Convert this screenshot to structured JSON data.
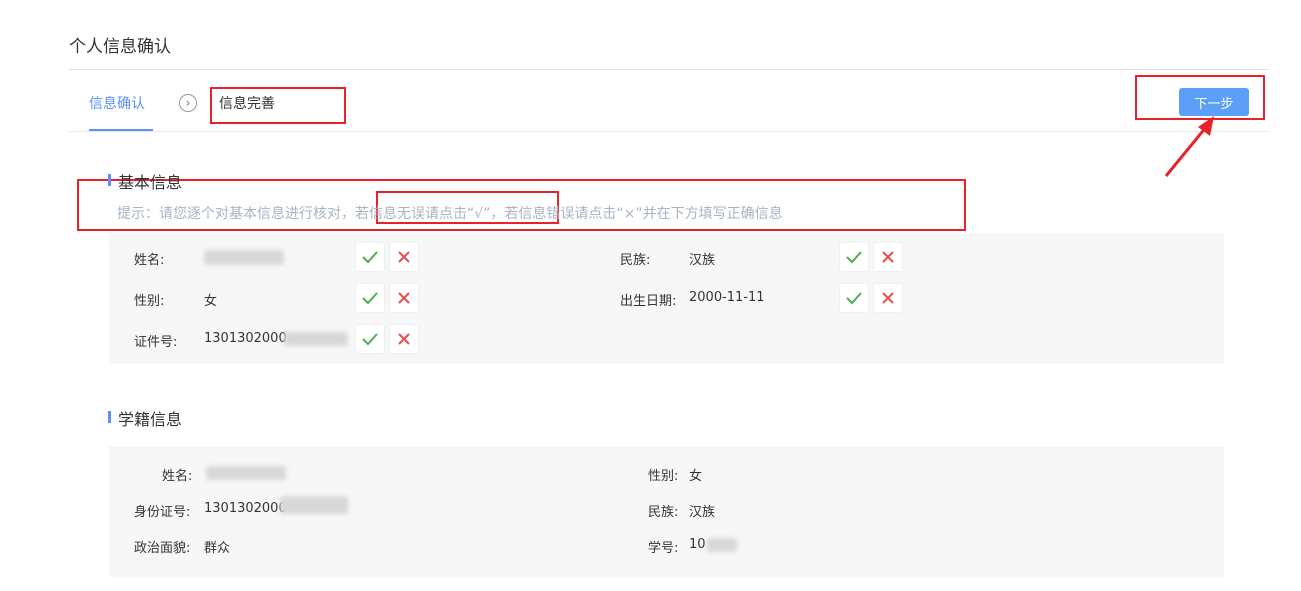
{
  "page": {
    "title": "个人信息确认"
  },
  "tabs": [
    {
      "label": "信息确认",
      "active": true
    },
    {
      "label": "信息完善",
      "active": false
    }
  ],
  "step_arrow_glyph": "›",
  "next_button": {
    "label": "下一步"
  },
  "basic_info": {
    "title": "基本信息",
    "hint": "提示：请您逐个对基本信息进行核对，若信息无误请点击“√”，若信息错误请点击“×”并在下方填写正确信息",
    "fields": [
      {
        "label": "姓名:",
        "value": ""
      },
      {
        "label": "民族:",
        "value": "汉族"
      },
      {
        "label": "性别:",
        "value": "女"
      },
      {
        "label": "出生日期:",
        "value": "2000-11-11"
      },
      {
        "label": "证件号:",
        "value": "1301302000"
      }
    ]
  },
  "school_info": {
    "title": "学籍信息",
    "fields": [
      {
        "label": "姓名:",
        "value": ""
      },
      {
        "label": "性别:",
        "value": "女"
      },
      {
        "label": "身份证号:",
        "value": "1301302000"
      },
      {
        "label": "民族:",
        "value": "汉族"
      },
      {
        "label": "政治面貌:",
        "value": "群众"
      },
      {
        "label": "学号:",
        "value": "10"
      }
    ]
  },
  "colors": {
    "accent": "#5b8ff9",
    "confirm": "#4caf50",
    "reject": "#e84c4c",
    "annotation": "#e8222a"
  },
  "icons": [
    "check-icon",
    "close-icon",
    "chevron-right-icon"
  ]
}
